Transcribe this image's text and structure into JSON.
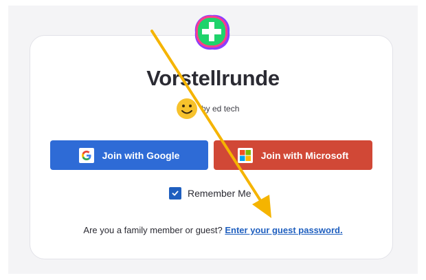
{
  "app": {
    "title": "Vorstellrunde",
    "byline": "by ed tech"
  },
  "buttons": {
    "google_label": "Join with Google",
    "microsoft_label": "Join with Microsoft"
  },
  "remember": {
    "label": "Remember Me",
    "checked": true
  },
  "guest": {
    "prompt": "Are you a family member or guest?",
    "link_label": "Enter your guest password."
  },
  "icons": {
    "logo": "flip-plus-logo-icon",
    "avatar": "smiley-face-icon",
    "google": "google-g-icon",
    "microsoft": "microsoft-windows-icon",
    "checkbox": "checkmark-icon",
    "annotation": "yellow-arrow-icon"
  },
  "colors": {
    "google_button": "#2e6bd6",
    "microsoft_button": "#d14836",
    "link": "#1f5fbf",
    "arrow": "#f5b400"
  }
}
